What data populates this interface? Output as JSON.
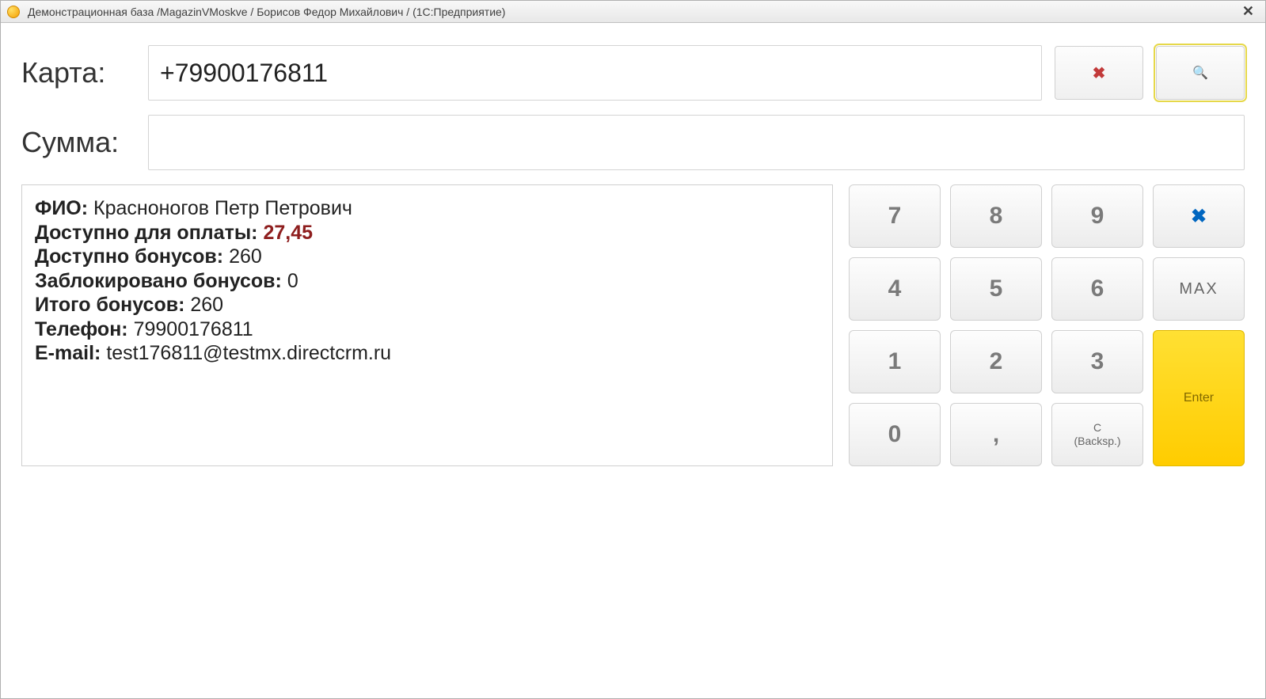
{
  "window": {
    "title": "Демонстрационная база /MagazinVMoskve / Борисов Федор Михайлович /  (1С:Предприятие)"
  },
  "form": {
    "card_label": "Карта:",
    "card_value": "+79900176811",
    "sum_label": "Сумма:",
    "sum_value": ""
  },
  "info": {
    "fio_label": "ФИО:",
    "fio_value": "Красноногов Петр Петрович",
    "avail_pay_label": "Доступно для оплаты:",
    "avail_pay_value": "27,45",
    "avail_bonus_label": "Доступно бонусов:",
    "avail_bonus_value": "260",
    "blocked_bonus_label": "Заблокировано бонусов:",
    "blocked_bonus_value": "0",
    "total_bonus_label": "Итого бонусов:",
    "total_bonus_value": "260",
    "phone_label": "Телефон:",
    "phone_value": "79900176811",
    "email_label": "E-mail:",
    "email_value": "test176811@testmx.directcrm.ru"
  },
  "keypad": {
    "k7": "7",
    "k8": "8",
    "k9": "9",
    "k4": "4",
    "k5": "5",
    "k6": "6",
    "k1": "1",
    "k2": "2",
    "k3": "3",
    "k0": "0",
    "comma": ",",
    "clear_line1": "C",
    "clear_line2": "(Backsp.)",
    "max": "MAX",
    "enter": "Enter",
    "delete_icon": "✖"
  },
  "icons": {
    "clear_x": "✖",
    "search": "🔍"
  }
}
